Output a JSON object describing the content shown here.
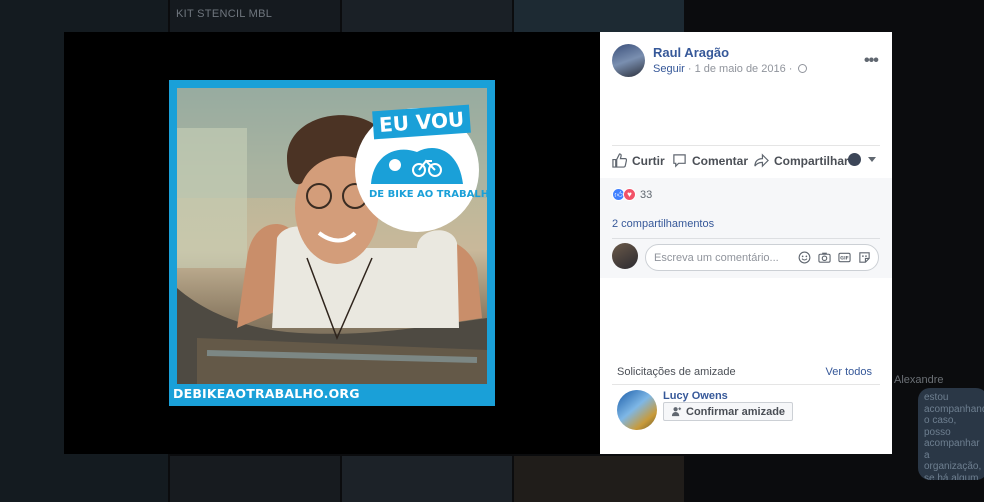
{
  "background": {
    "top_label": "KIT STENCIL MBL",
    "chat_name": "Alexandre",
    "chat_text": "estou acompanhando o caso, posso acompanhar a organização, se há algum apoio e fica pra apoio"
  },
  "photo": {
    "badge_top": "EU VOU",
    "badge_text": "DE BIKE AO TRABALHO",
    "url": "DEBIKEAOTRABALHO.ORG"
  },
  "post": {
    "author": "Raul Aragão",
    "follow": "Seguir",
    "separator": " · ",
    "date": "1 de maio de 2016",
    "separator2": " · ",
    "more_label": "•••"
  },
  "actions": {
    "like": "Curtir",
    "comment": "Comentar",
    "share": "Compartilhar"
  },
  "feedback": {
    "reaction_count": "33",
    "shares": "2 compartilhamentos",
    "comment_placeholder": "Escreva um comentário..."
  },
  "friend_requests": {
    "header": "Solicitações de amizade",
    "see_all": "Ver todos",
    "name": "Lucy Owens",
    "confirm": "Confirmar amizade"
  },
  "colors": {
    "facebook_link": "#365899",
    "campaign_blue": "#1aa0d8",
    "like_blue": "#4080ff",
    "love_red": "#f25268"
  }
}
